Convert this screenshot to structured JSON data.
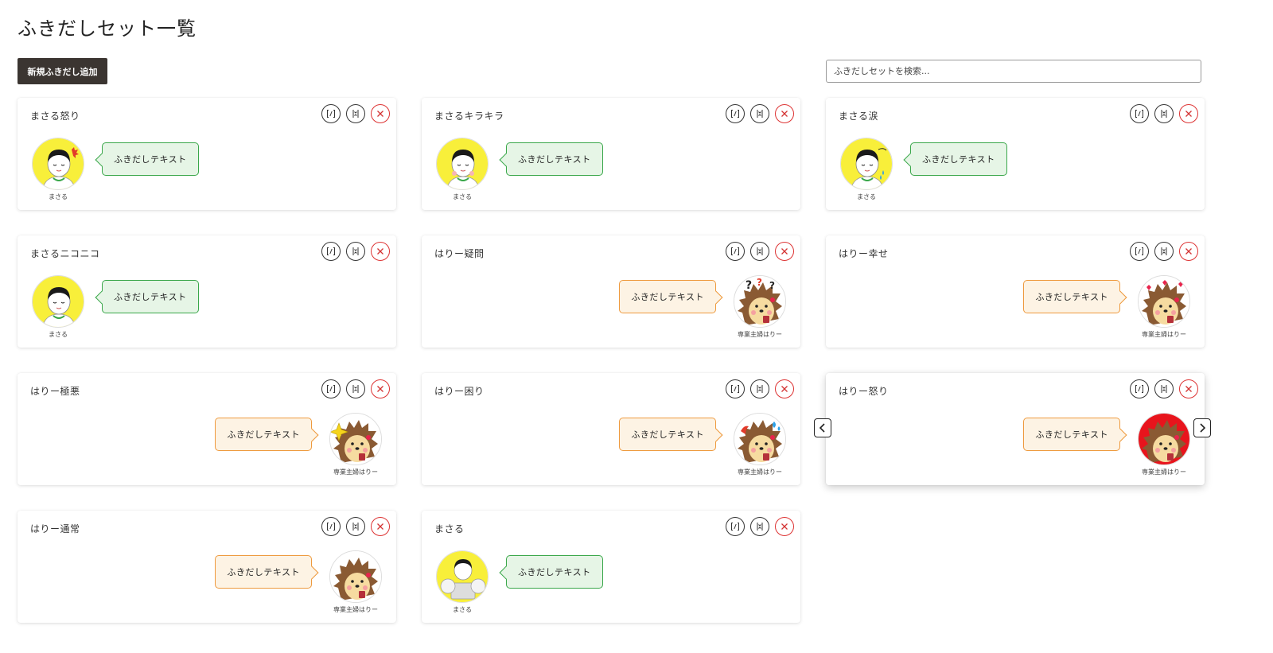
{
  "page": {
    "title": "ふきだしセット一覧",
    "add_button_label": "新規ふきだし追加",
    "search_placeholder": "ふきだしセットを検索..."
  },
  "colors": {
    "left_bubble_bg": "#e6f5e6",
    "left_bubble_border": "#3aa74a",
    "right_bubble_bg": "#fdf3e4",
    "right_bubble_border": "#ee9a3e",
    "delete_icon": "#d33333",
    "add_button_bg": "#3b3531"
  },
  "action_icons": [
    "edit-icon",
    "duplicate-icon",
    "delete-icon"
  ],
  "cards": [
    {
      "title": "まさる怒り",
      "bubble_text": "ふきだしテキスト",
      "avatar_name": "まさる",
      "side": "left",
      "character": "masaru",
      "expression": "angry"
    },
    {
      "title": "まさるキラキラ",
      "bubble_text": "ふきだしテキスト",
      "avatar_name": "まさる",
      "side": "left",
      "character": "masaru",
      "expression": "sparkle"
    },
    {
      "title": "まさる涙",
      "bubble_text": "ふきだしテキスト",
      "avatar_name": "まさる",
      "side": "left",
      "character": "masaru",
      "expression": "tears"
    },
    {
      "title": "まさるニコニコ",
      "bubble_text": "ふきだしテキスト",
      "avatar_name": "まさる",
      "side": "left",
      "character": "masaru",
      "expression": "smile"
    },
    {
      "title": "はりー疑問",
      "bubble_text": "ふきだしテキスト",
      "avatar_name": "専業主婦はりー",
      "side": "right",
      "character": "harry",
      "expression": "question"
    },
    {
      "title": "はりー幸せ",
      "bubble_text": "ふきだしテキスト",
      "avatar_name": "専業主婦はりー",
      "side": "right",
      "character": "harry",
      "expression": "happy"
    },
    {
      "title": "はりー極悪",
      "bubble_text": "ふきだしテキスト",
      "avatar_name": "専業主婦はりー",
      "side": "right",
      "character": "harry",
      "expression": "evil"
    },
    {
      "title": "はりー困り",
      "bubble_text": "ふきだしテキスト",
      "avatar_name": "専業主婦はりー",
      "side": "right",
      "character": "harry",
      "expression": "troubled"
    },
    {
      "title": "はりー怒り",
      "bubble_text": "ふきだしテキスト",
      "avatar_name": "専業主婦はりー",
      "side": "right",
      "character": "harry",
      "expression": "angry",
      "active": true
    },
    {
      "title": "はりー通常",
      "bubble_text": "ふきだしテキスト",
      "avatar_name": "専業主婦はりー",
      "side": "right",
      "character": "harry",
      "expression": "normal"
    },
    {
      "title": "まさる",
      "bubble_text": "ふきだしテキスト",
      "avatar_name": "まさる",
      "side": "left",
      "character": "masaru",
      "expression": "family"
    }
  ],
  "carousel": {
    "prev_icon": "chevron-left-icon",
    "next_icon": "chevron-right-icon"
  }
}
